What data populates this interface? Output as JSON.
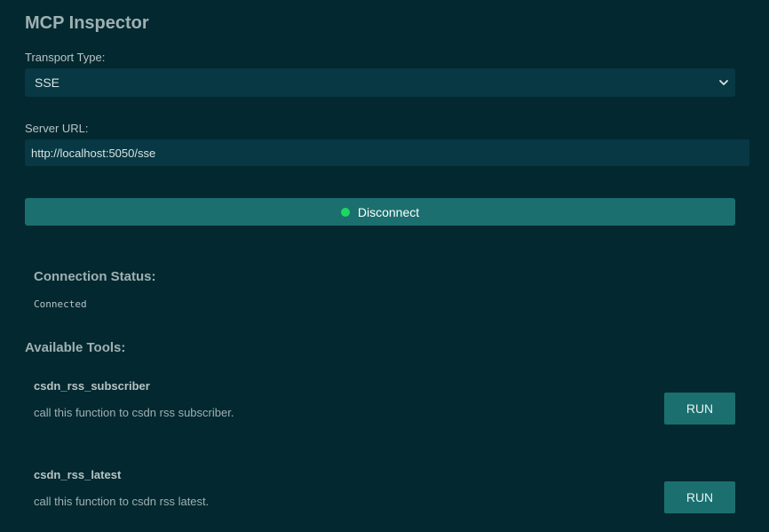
{
  "app": {
    "title": "MCP Inspector"
  },
  "transport": {
    "label": "Transport Type:",
    "selected": "SSE"
  },
  "server": {
    "label": "Server URL:",
    "value": "http://localhost:5050/sse"
  },
  "connection": {
    "button_label": "Disconnect",
    "status_heading": "Connection Status:",
    "status_text": "Connected",
    "status_color": "#1ed760"
  },
  "tools": {
    "heading": "Available Tools:",
    "items": [
      {
        "name": "csdn_rss_subscriber",
        "description": "call this function to csdn rss subscriber.",
        "run_label": "RUN"
      },
      {
        "name": "csdn_rss_latest",
        "description": "call this function to csdn rss latest.",
        "run_label": "RUN"
      }
    ]
  },
  "colors": {
    "background": "#032830",
    "input_bg": "#073843",
    "accent": "#1b6f6f"
  }
}
